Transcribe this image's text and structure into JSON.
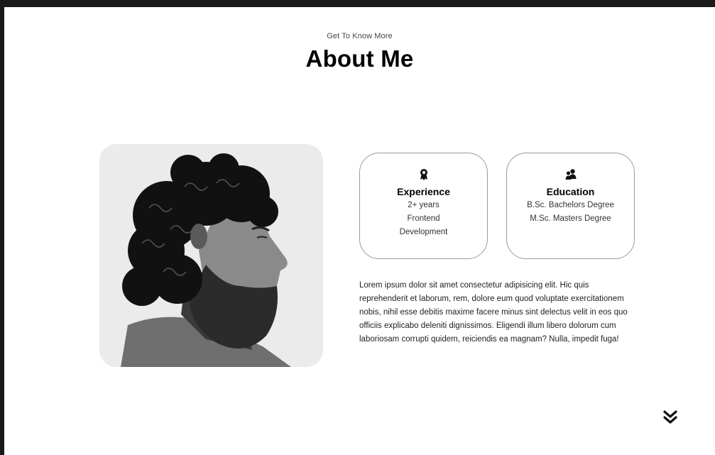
{
  "section": {
    "eyebrow": "Get To Know More",
    "title": "About Me"
  },
  "cards": {
    "experience": {
      "icon": "award-icon",
      "title": "Experience",
      "lines": [
        "2+ years",
        "Frontend",
        "Development"
      ]
    },
    "education": {
      "icon": "users-icon",
      "title": "Education",
      "lines": [
        "B.Sc. Bachelors Degree",
        "M.Sc. Masters Degree"
      ]
    }
  },
  "about": {
    "text": "Lorem ipsum dolor sit amet consectetur adipisicing elit. Hic quis reprehenderit et laborum, rem, dolore eum quod voluptate exercitationem nobis, nihil esse debitis maxime facere minus sint delectus velit in eos quo officiis explicabo deleniti dignissimos. Eligendi illum libero dolorum cum laboriosam corrupti quidem, reiciendis ea magnam? Nulla, impedit fuga!"
  },
  "nav": {
    "scroll_icon": "double-chevron-down-icon"
  },
  "colors": {
    "text": "#000000",
    "border": "#9a9a9a",
    "frame": "#1a1a1a"
  }
}
